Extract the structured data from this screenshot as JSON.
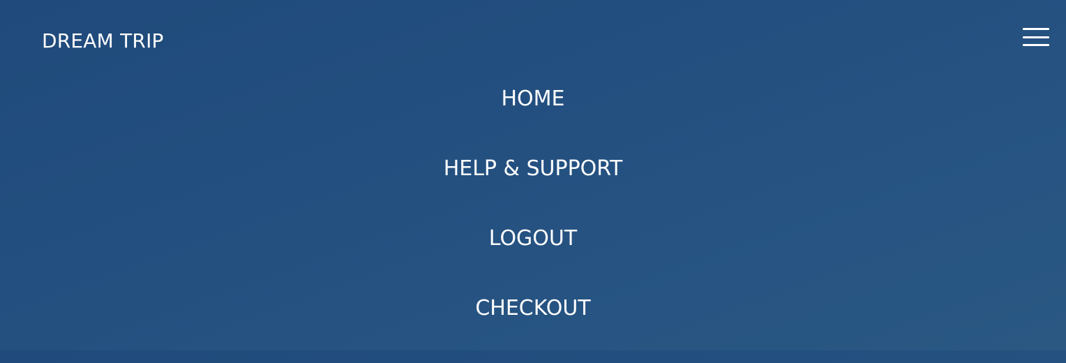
{
  "header": {
    "brand": "DREAM TRIP",
    "menu_icon": "hamburger-menu-icon"
  },
  "nav": {
    "items": [
      {
        "label": "HOME"
      },
      {
        "label": "HELP & SUPPORT"
      },
      {
        "label": "LOGOUT"
      },
      {
        "label": "CHECKOUT"
      }
    ]
  },
  "colors": {
    "background": "#234f80",
    "text": "#ffffff"
  }
}
